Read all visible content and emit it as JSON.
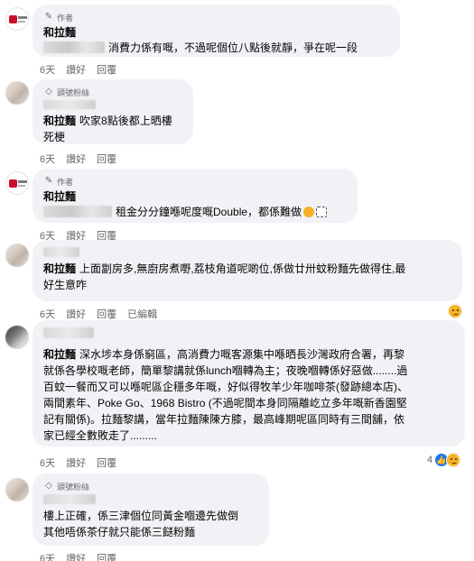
{
  "comments": [
    {
      "badge": "作者",
      "author": "和拉麵",
      "text": "消費力係有嘅，不過呢個位八點後就靜，爭在呢一段",
      "time": "6天",
      "like": "讚好",
      "reply": "回覆"
    },
    {
      "badge": "頭號粉絲",
      "author": "和拉麵",
      "text": "吹家8點後都上晒樓死梗",
      "text_line1": "吹家8點後都上晒樓",
      "text_line2": "死梗",
      "time": "6天",
      "like": "讚好",
      "reply": "回覆"
    },
    {
      "badge": "作者",
      "author": "和拉麵",
      "text": "租金分分鐘喺呢度嘅Double，都係難做",
      "time": "6天",
      "like": "讚好",
      "reply": "回覆"
    },
    {
      "author": "和拉麵",
      "text_line1": "上面劏房多,無廚房煮嘢,荔枝角道呢啲位,係做廿卅蚊粉麵先做得住,最",
      "text_line2": "好生意咋",
      "time": "6天",
      "like": "讚好",
      "reply": "回覆",
      "edited": "已編輯"
    },
    {
      "author": "和拉麵",
      "lines": [
        "深水埗本身係窮區，高消費力嘅客源集中喺晒長沙灣政府合署，再黎",
        "就係各學校嘅老師，簡單黎講就係lunch嗰轉為主；夜晚嗰轉係好惡做........過",
        "百蚊一餐而又可以喺呢區企穩多年嘅，好似得牧羊少年咖啡茶(發跡總本店)、",
        "兩間素年、Poke Go、1968 Bistro (不過呢間本身同隔離屹立多年嘅新香園堅",
        "記有關係)。拉麵黎講，當年拉麵陳陳方膝，最高峰期呢區同時有三間舖，依",
        "家已經全數敗走了........."
      ],
      "time": "6天",
      "like": "讚好",
      "reply": "回覆",
      "reaction_count": "4"
    },
    {
      "badge": "頭號粉絲",
      "lines": [
        "樓上正確，係三津個位同黃金嗰邊先做倒",
        "其他唔係茶仔就只能係三餸粉麵"
      ],
      "time": "6天",
      "like": "讚好",
      "reply": "回覆"
    }
  ],
  "colors": {
    "bubble": "#f0f2f5",
    "meta": "#65676b",
    "like_reaction": "#1877f2",
    "sad_reaction": "#f7b125",
    "logo_red": "#c8102e"
  }
}
